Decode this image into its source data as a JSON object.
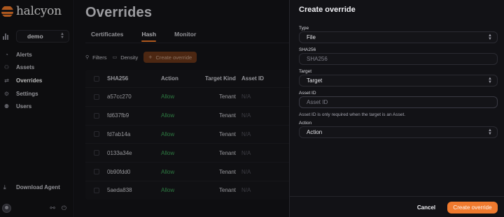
{
  "brand": {
    "name": "halcyon",
    "accent": "#f27a2a"
  },
  "org": {
    "selected": "demo"
  },
  "nav": {
    "items": [
      {
        "label": "Alerts",
        "icon": "alert-icon"
      },
      {
        "label": "Assets",
        "icon": "assets-icon"
      },
      {
        "label": "Overrides",
        "icon": "overrides-icon"
      },
      {
        "label": "Settings",
        "icon": "gear-icon"
      },
      {
        "label": "Users",
        "icon": "users-icon"
      }
    ],
    "download": "Download Agent"
  },
  "page": {
    "title": "Overrides",
    "tabs": [
      {
        "label": "Certificates"
      },
      {
        "label": "Hash",
        "active": true
      },
      {
        "label": "Monitor"
      }
    ]
  },
  "toolbar": {
    "filters": "Filters",
    "density": "Density",
    "create": "Create override"
  },
  "table": {
    "columns": [
      "SHA256",
      "Action",
      "Target Kind",
      "Asset ID"
    ],
    "rows": [
      {
        "sha": "a57cc270",
        "action": "Allow",
        "kind": "Tenant",
        "asset": "N/A"
      },
      {
        "sha": "fd637fb9",
        "action": "Allow",
        "kind": "Tenant",
        "asset": "N/A"
      },
      {
        "sha": "fd7ab14a",
        "action": "Allow",
        "kind": "Tenant",
        "asset": "N/A"
      },
      {
        "sha": "0133a34e",
        "action": "Allow",
        "kind": "Tenant",
        "asset": "N/A"
      },
      {
        "sha": "0b90fdd0",
        "action": "Allow",
        "kind": "Tenant",
        "asset": "N/A"
      },
      {
        "sha": "5aeda838",
        "action": "Allow",
        "kind": "Tenant",
        "asset": "N/A"
      }
    ]
  },
  "panel": {
    "title": "Create override",
    "type": {
      "label": "Type",
      "value": "File"
    },
    "sha": {
      "label": "SHA256",
      "placeholder": "SHA256"
    },
    "target": {
      "label": "Target",
      "value": "Target"
    },
    "asset": {
      "label": "Asset ID",
      "placeholder": "Asset ID",
      "help": "Asset ID is only required when the target is an Asset."
    },
    "action": {
      "label": "Action",
      "value": "Action"
    },
    "cancel": "Cancel",
    "create": "Create override"
  }
}
